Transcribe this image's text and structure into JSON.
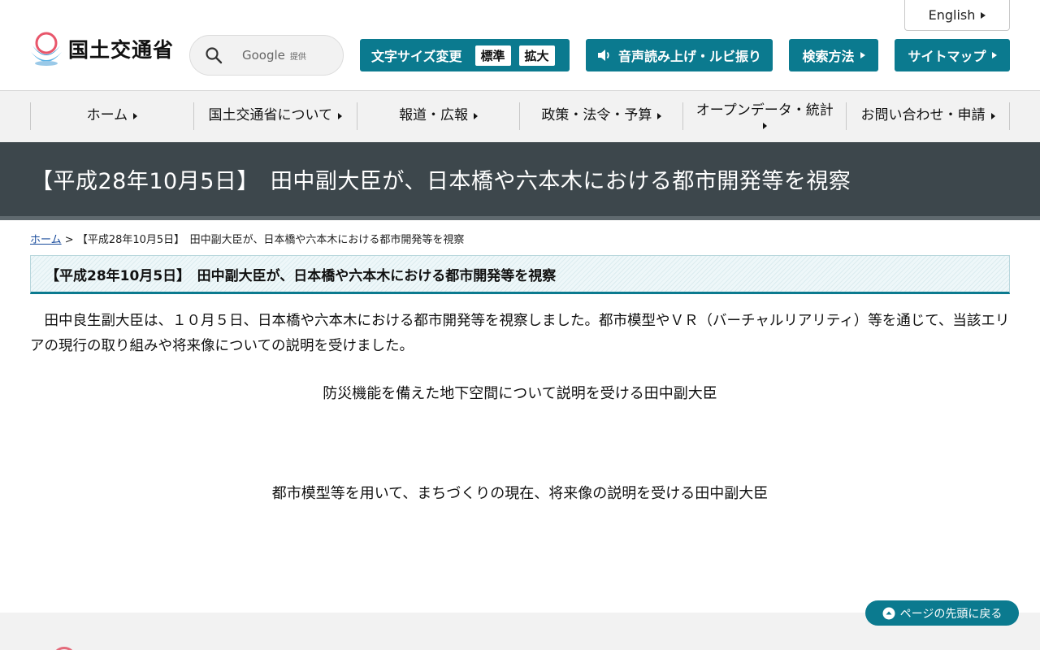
{
  "header": {
    "english_label": "English",
    "logo_text": "国土交通省",
    "search": {
      "brand": "Google",
      "brand_suffix": "提供"
    },
    "toolbar": {
      "size_label": "文字サイズ変更",
      "size_standard": "標準",
      "size_large": "拡大",
      "voice_label": "音声読み上げ・ルビ振り",
      "howto_label": "検索方法",
      "sitemap_label": "サイトマップ"
    }
  },
  "nav": {
    "items": [
      {
        "label": "ホーム"
      },
      {
        "label": "国土交通省について"
      },
      {
        "label": "報道・広報"
      },
      {
        "label": "政策・法令・予算"
      },
      {
        "label": "オープンデータ・統計"
      },
      {
        "label": "お問い合わせ・申請"
      }
    ]
  },
  "page": {
    "title": "【平成28年10月5日】　田中副大臣が、日本橋や六本木における都市開発等を視察",
    "breadcrumb": {
      "home": "ホーム",
      "sep": ">",
      "current": "【平成28年10月5日】　田中副大臣が、日本橋や六本木における都市開発等を視察"
    },
    "heading": "【平成28年10月5日】　田中副大臣が、日本橋や六本木における都市開発等を視察",
    "body": "　田中良生副大臣は、１０月５日、日本橋や六本木における都市開発等を視察しました。都市模型やＶＲ（バーチャルリアリティ）等を通じて、当該エリアの現行の取り組みや将来像についての説明を受けました。",
    "caption1": "防災機能を備えた地下空間について説明を受ける田中副大臣",
    "caption2": "都市模型等を用いて、まちづくりの現在、将来像の説明を受ける田中副大臣"
  },
  "pagetop_label": "ページの先頭に戻る",
  "colors": {
    "accent": "#0b7a8f",
    "title_band": "#3d474c",
    "nav_bg": "#f2f2f2"
  }
}
